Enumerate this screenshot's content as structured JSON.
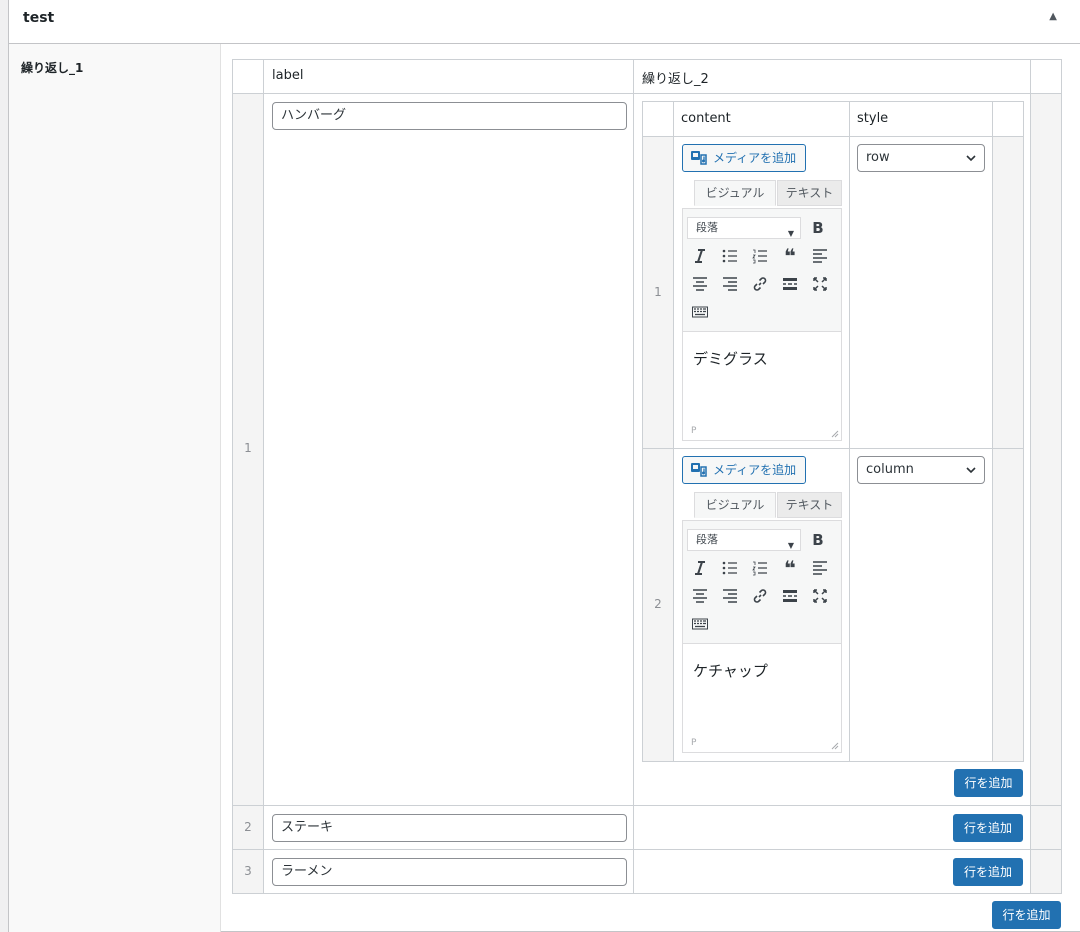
{
  "metabox": {
    "title": "test"
  },
  "field_label": "繰り返し_1",
  "outer_table": {
    "headers": [
      "label",
      "繰り返し_2"
    ],
    "rows": [
      {
        "num": "1",
        "label_value": "ハンバーグ"
      },
      {
        "num": "2",
        "label_value": "ステーキ"
      },
      {
        "num": "3",
        "label_value": "ラーメン"
      }
    ]
  },
  "inner_table": {
    "headers": [
      "content",
      "style"
    ],
    "rows": [
      {
        "num": "1",
        "content": "デミグラス",
        "style": "row"
      },
      {
        "num": "2",
        "content": "ケチャップ",
        "style": "column"
      }
    ]
  },
  "editor": {
    "media_button": "メディアを追加",
    "tab_visual": "ビジュアル",
    "tab_text": "テキスト",
    "format_select": "段落",
    "path": "P"
  },
  "add_row_button": "行を追加",
  "colors": {
    "accent": "#2271b1",
    "border": "#ccd0d4"
  },
  "icons": [
    "collapse-arrow-icon",
    "media-icon",
    "chevron-down-icon",
    "bold-icon",
    "italic-icon",
    "bullet-list-icon",
    "numbered-list-icon",
    "blockquote-icon",
    "align-left-icon",
    "align-center-icon",
    "align-right-icon",
    "link-icon",
    "read-more-icon",
    "fullscreen-icon",
    "toolbar-toggle-icon",
    "resize-handle-icon"
  ]
}
